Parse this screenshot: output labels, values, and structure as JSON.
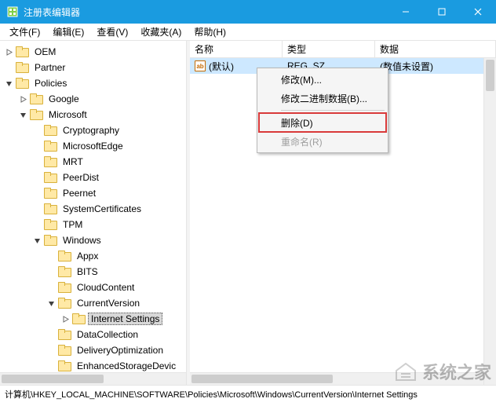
{
  "window": {
    "title": "注册表编辑器"
  },
  "menubar": {
    "items": [
      {
        "label": "文件(F)"
      },
      {
        "label": "编辑(E)"
      },
      {
        "label": "查看(V)"
      },
      {
        "label": "收藏夹(A)"
      },
      {
        "label": "帮助(H)"
      }
    ]
  },
  "tree": {
    "nodes": [
      {
        "label": "OEM",
        "expander": "collapsed",
        "depth": 0
      },
      {
        "label": "Partner",
        "expander": "none",
        "depth": 0
      },
      {
        "label": "Policies",
        "expander": "expanded",
        "depth": 0
      },
      {
        "label": "Google",
        "expander": "collapsed",
        "depth": 1
      },
      {
        "label": "Microsoft",
        "expander": "expanded",
        "depth": 1
      },
      {
        "label": "Cryptography",
        "expander": "none",
        "depth": 2
      },
      {
        "label": "MicrosoftEdge",
        "expander": "none",
        "depth": 2
      },
      {
        "label": "MRT",
        "expander": "none",
        "depth": 2
      },
      {
        "label": "PeerDist",
        "expander": "none",
        "depth": 2
      },
      {
        "label": "Peernet",
        "expander": "none",
        "depth": 2
      },
      {
        "label": "SystemCertificates",
        "expander": "none",
        "depth": 2
      },
      {
        "label": "TPM",
        "expander": "none",
        "depth": 2
      },
      {
        "label": "Windows",
        "expander": "expanded",
        "depth": 2
      },
      {
        "label": "Appx",
        "expander": "none",
        "depth": 3
      },
      {
        "label": "BITS",
        "expander": "none",
        "depth": 3
      },
      {
        "label": "CloudContent",
        "expander": "none",
        "depth": 3
      },
      {
        "label": "CurrentVersion",
        "expander": "expanded",
        "depth": 3
      },
      {
        "label": "Internet Settings",
        "expander": "collapsed",
        "depth": 4,
        "selected": true
      },
      {
        "label": "DataCollection",
        "expander": "none",
        "depth": 3
      },
      {
        "label": "DeliveryOptimization",
        "expander": "none",
        "depth": 3
      },
      {
        "label": "EnhancedStorageDevic",
        "expander": "none",
        "depth": 3
      }
    ]
  },
  "list": {
    "columns": {
      "name": "名称",
      "type": "类型",
      "data": "数据"
    },
    "rows": [
      {
        "name": "(默认)",
        "type": "REG_SZ",
        "data": "(数值未设置)",
        "selected": true,
        "icon_text": "ab"
      }
    ]
  },
  "context_menu": {
    "items": [
      {
        "label": "修改(M)...",
        "state": "normal"
      },
      {
        "label": "修改二进制数据(B)...",
        "state": "normal"
      },
      {
        "sep": true
      },
      {
        "label": "删除(D)",
        "state": "highlight"
      },
      {
        "label": "重命名(R)",
        "state": "disabled"
      }
    ]
  },
  "statusbar": {
    "path": "计算机\\HKEY_LOCAL_MACHINE\\SOFTWARE\\Policies\\Microsoft\\Windows\\CurrentVersion\\Internet Settings"
  },
  "watermark": {
    "text": "系统之家"
  }
}
